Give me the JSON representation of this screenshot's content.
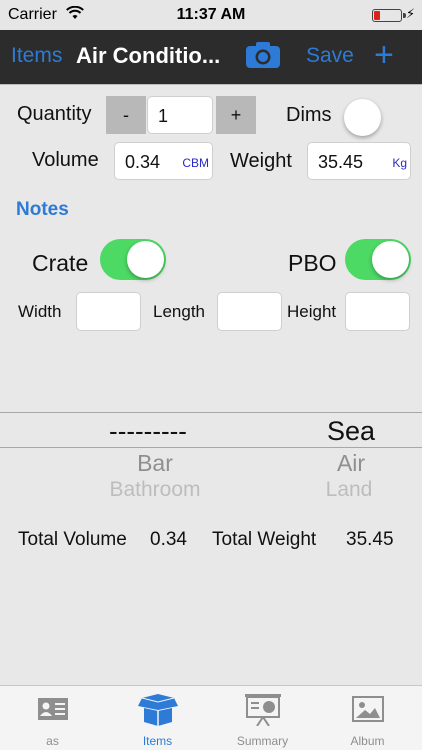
{
  "status_bar": {
    "carrier": "Carrier",
    "time": "11:37 AM"
  },
  "nav": {
    "back_label": "Items",
    "title": "Air Conditio...",
    "save_label": "Save",
    "add_symbol": "+"
  },
  "quantity": {
    "label": "Quantity",
    "minus": "-",
    "value": "1",
    "plus": "+"
  },
  "dims": {
    "label": "Dims",
    "on": false
  },
  "volume": {
    "label": "Volume",
    "value": "0.34",
    "unit": "CBM"
  },
  "weight": {
    "label": "Weight",
    "value": "35.45",
    "unit": "Kg"
  },
  "notes_label": "Notes",
  "crate": {
    "label": "Crate",
    "on": true
  },
  "pbo": {
    "label": "PBO",
    "on": true
  },
  "dimensions": {
    "width_label": "Width",
    "length_label": "Length",
    "height_label": "Height",
    "width_value": "",
    "length_value": "",
    "height_value": ""
  },
  "picker": {
    "left": {
      "selected": "---------",
      "next": "Bar",
      "after": "Bathroom"
    },
    "right": {
      "selected": "Sea",
      "next": "Air",
      "after": "Land"
    }
  },
  "totals": {
    "volume_label": "Total Volume",
    "volume_value": "0.34",
    "weight_label": "Total Weight",
    "weight_value": "35.45"
  },
  "tabs": [
    {
      "label": "as",
      "icon": "contact-card-icon",
      "active": false
    },
    {
      "label": "Items",
      "icon": "open-box-icon",
      "active": true
    },
    {
      "label": "Summary",
      "icon": "presentation-board-icon",
      "active": false
    },
    {
      "label": "Album",
      "icon": "photo-icon",
      "active": false
    }
  ],
  "colors": {
    "accent": "#2d7bd6",
    "switch_on": "#4cd964",
    "nav_bg": "#2c2c2c",
    "battery_low": "#e0201b"
  }
}
